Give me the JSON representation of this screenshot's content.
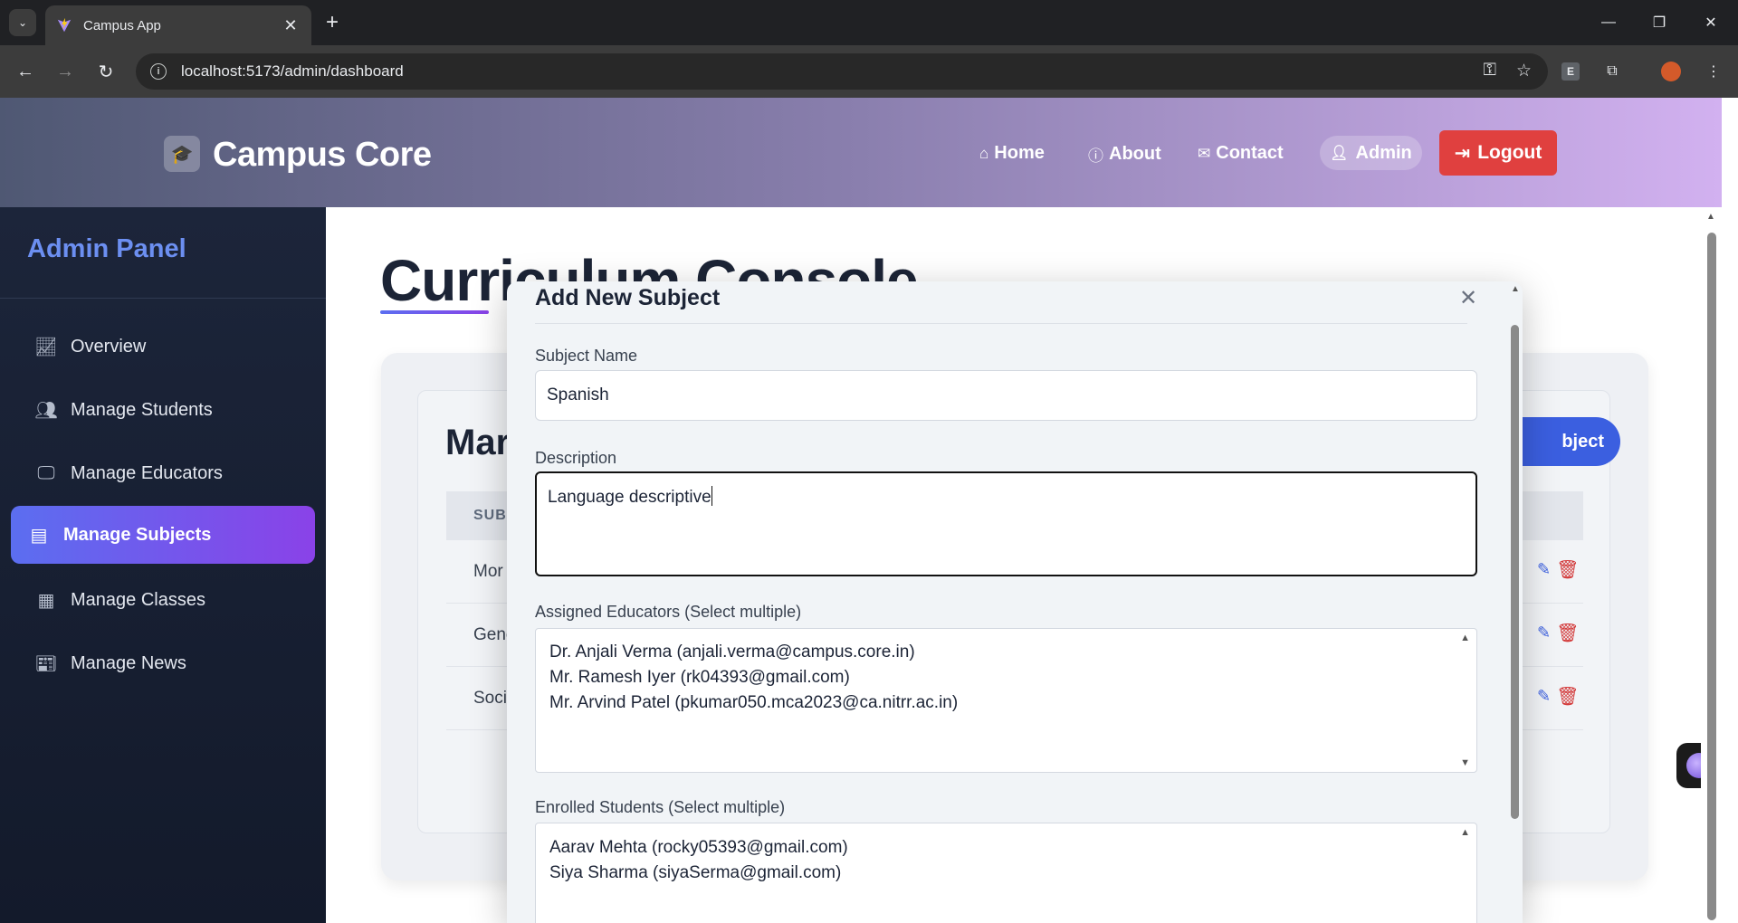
{
  "browser": {
    "tab_title": "Campus App",
    "url": "localhost:5173/admin/dashboard",
    "ext_letter": "E"
  },
  "header": {
    "brand": "Campus Core",
    "nav": {
      "home": "Home",
      "about": "About",
      "contact": "Contact",
      "admin": "Admin",
      "logout": "Logout"
    }
  },
  "sidebar": {
    "title": "Admin Panel",
    "items": [
      {
        "label": "Overview",
        "icon": "chart-line-icon"
      },
      {
        "label": "Manage Students",
        "icon": "users-icon"
      },
      {
        "label": "Manage Educators",
        "icon": "chalkboard-teacher-icon"
      },
      {
        "label": "Manage Subjects",
        "icon": "book-icon",
        "active": true
      },
      {
        "label": "Manage Classes",
        "icon": "building-icon"
      },
      {
        "label": "Manage News",
        "icon": "newspaper-icon"
      }
    ]
  },
  "main": {
    "page_title": "Curriculum Console",
    "card_title": "Mar",
    "add_button": "bject",
    "table": {
      "header_subject": "SUB.",
      "rows": [
        "Mor",
        "Gene",
        "Soci"
      ]
    }
  },
  "modal": {
    "title": "Add New Subject",
    "subject_name_label": "Subject Name",
    "subject_name_value": "Spanish",
    "description_label": "Description",
    "description_value": "Language descriptive",
    "educators_label": "Assigned Educators (Select multiple)",
    "educators": [
      "Dr. Anjali Verma (anjali.verma@campus.core.in)",
      "Mr. Ramesh Iyer (rk04393@gmail.com)",
      "Mr. Arvind Patel (pkumar050.mca2023@ca.nitrr.ac.in)"
    ],
    "students_label": "Enrolled Students (Select multiple)",
    "students": [
      "Aarav Mehta (rocky05393@gmail.com)",
      "Siya Sharma (siyaSerma@gmail.com)"
    ]
  }
}
